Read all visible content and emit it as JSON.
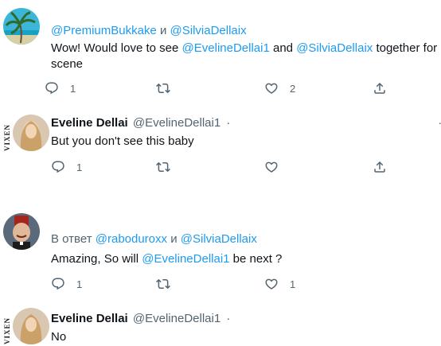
{
  "tweets": [
    {
      "reply_prefix": "",
      "reply_to_1": "@PremiumBukkake",
      "reply_and": " и ",
      "reply_to_2": "@SilviaDellaix",
      "text_part_1": "Wow! Would love to see ",
      "text_mention_1": "@EvelineDellai1",
      "text_part_2": " and ",
      "text_mention_2": "@SilviaDellaix",
      "text_part_3": " together for a",
      "text_line_2": "scene",
      "reply_count": "1",
      "retweet_count": "",
      "like_count": "2"
    },
    {
      "name": "Eveline Dellai",
      "handle": "@EvelineDellai1",
      "dot": "·",
      "avatar_label": "VIXEN",
      "text": "But you don't see this baby",
      "reply_count": "1",
      "retweet_count": "",
      "like_count": ""
    },
    {
      "reply_prefix": "В ответ ",
      "reply_to_1": "@raboduroxx",
      "reply_and": " и ",
      "reply_to_2": "@SilviaDellaix",
      "text_part_1": "Amazing,  So will ",
      "text_mention_1": "@EvelineDellai1",
      "text_part_2": " be next ?",
      "reply_count": "1",
      "retweet_count": "",
      "like_count": "1"
    },
    {
      "name": "Eveline Dellai",
      "handle": "@EvelineDellai1",
      "dot": "·",
      "avatar_label": "VIXEN",
      "text": "No"
    }
  ],
  "colors": {
    "accent": "#1d9bf0",
    "muted": "#536471",
    "text": "#0f1419"
  },
  "icons": {
    "reply": "reply-icon",
    "retweet": "retweet-icon",
    "like": "heart-icon",
    "share": "share-icon",
    "more": "more-icon"
  }
}
